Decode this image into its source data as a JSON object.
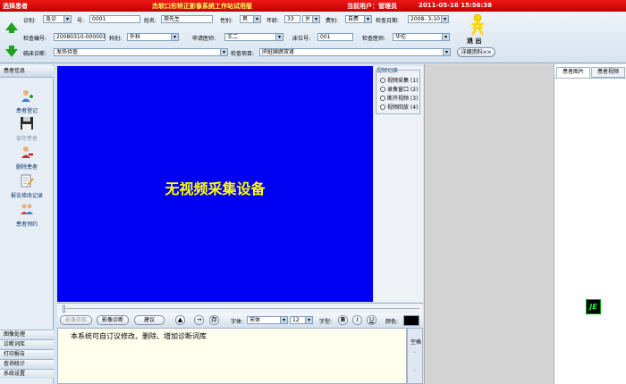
{
  "titlebar": {
    "left": "选择患者",
    "title": "杰软口形矫正影像系统工作站试用版",
    "user": "当前用户：管理员",
    "datetime": "2011-05-16 15:56:38"
  },
  "header": {
    "dept_label": "诊别:",
    "dept_value": "急诊",
    "no_label": "号:",
    "no_value": "0001",
    "name_label": "姓名:",
    "name_value": "周先生",
    "sex_label": "性别:",
    "sex_value": "男",
    "age_label": "年龄:",
    "age_value": "33",
    "age_unit": "岁",
    "fee_label": "费别:",
    "fee_value": "自费",
    "date_label": "检查日期:",
    "date_value": "2008- 3-10",
    "exam_no_label": "检查编号:",
    "exam_no_value": "20080310-000001",
    "section_label": "科别:",
    "section_value": "外科",
    "doctor_label": "申请医师:",
    "doctor_value": "王二",
    "bed_label": "床位号:",
    "bed_value": "001",
    "checker_label": "检查医师:",
    "checker_value": "华佗",
    "diag_label": "临床诊断:",
    "diag_value": "发热待查",
    "item_label": "检查项目:",
    "item_value": "肝脏胰脾双肾",
    "detail_button": "详细资料>>",
    "exit_label": "退 出"
  },
  "sidebar": {
    "header": "患者信息",
    "items": [
      {
        "label": "患者登记",
        "icon": "register-icon"
      },
      {
        "label": "保存患者",
        "icon": "save-icon"
      },
      {
        "label": "删除患者",
        "icon": "delete-icon"
      },
      {
        "label": "报告修改记录",
        "icon": "report-edit-icon"
      },
      {
        "label": "患者预约",
        "icon": "appointment-icon"
      }
    ],
    "bottom": [
      "图像处理",
      "诊断词库",
      "打印报告",
      "查询统计",
      "系统设置"
    ]
  },
  "video": {
    "no_device": "无视频采集设备"
  },
  "switch": {
    "title": "视频切换",
    "options": [
      "视频采集 (1)",
      "录像窗口 (2)",
      "断开视频 (3)",
      "视频回放 (4)"
    ]
  },
  "rightpanel": {
    "tabs": [
      "患者图片",
      "患者视频"
    ],
    "logo": "JE"
  },
  "toolbar": {
    "capture": "影像获取",
    "diagnose": "影像诊断",
    "suggest": "建议",
    "up": "▲",
    "arrow": "→",
    "save": "存",
    "font_label": "字体:",
    "font_value": "宋体",
    "size_value": "12",
    "style_label": "字型:",
    "bold": "B",
    "italic": "I",
    "underline": "U",
    "color_label": "颜色:"
  },
  "textarea": {
    "content": "本系统可自订议修改、删除、增加诊断词库"
  },
  "sidescroll": {
    "label": "空格"
  },
  "colors": {
    "titlebar": "#d00000",
    "video_bg": "#0000f2",
    "no_device_text": "#ffff00"
  }
}
